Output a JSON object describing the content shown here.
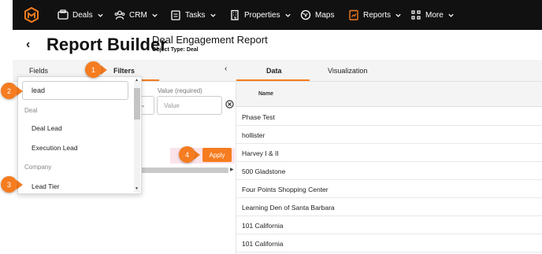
{
  "nav": {
    "items": [
      {
        "label": "Deals",
        "icon": "deals-icon"
      },
      {
        "label": "CRM",
        "icon": "crm-icon"
      },
      {
        "label": "Tasks",
        "icon": "tasks-icon"
      },
      {
        "label": "Properties",
        "icon": "properties-icon"
      },
      {
        "label": "Maps",
        "icon": "maps-icon"
      },
      {
        "label": "Reports",
        "icon": "reports-icon"
      },
      {
        "label": "More",
        "icon": "more-icon"
      }
    ],
    "accent": "#f57c20"
  },
  "header": {
    "title": "Report Builder",
    "report_name": "Deal Engagement Report",
    "object_type": "Object Type: Deal"
  },
  "left": {
    "tabs": [
      "Fields",
      "Filters"
    ],
    "active_tab": "Filters",
    "value_label": "Value (required)",
    "value_placeholder": "Value",
    "apply_label": "Apply"
  },
  "dropdown": {
    "search_value": "lead",
    "groups": [
      {
        "name": "Deal",
        "items": [
          "Deal Lead",
          "Execution Lead"
        ]
      },
      {
        "name": "Company",
        "items": [
          "Lead Tier"
        ]
      }
    ]
  },
  "right": {
    "tabs": [
      "Data",
      "Visualization"
    ],
    "active_tab": "Data",
    "column_header": "Name",
    "rows": [
      "Phase Test",
      "hollister",
      "Harvey I & II",
      "500 Gladstone",
      "Four Points Shopping Center",
      "Learning Den of Santa Barbara",
      "101 California",
      "101 California"
    ]
  },
  "annotations": [
    "1",
    "2",
    "3",
    "4"
  ]
}
